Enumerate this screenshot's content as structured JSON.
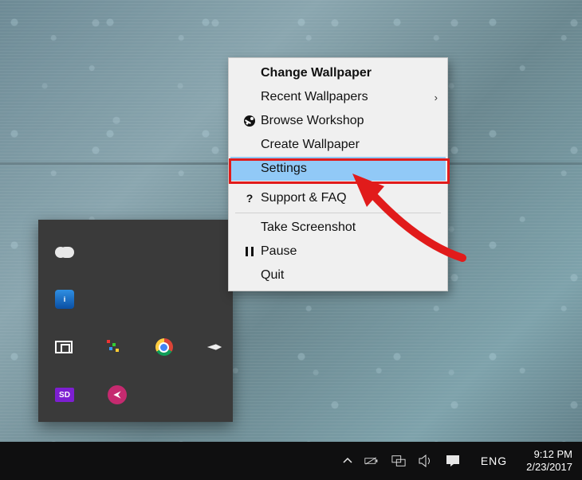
{
  "context_menu": {
    "heading": "Change Wallpaper",
    "items": {
      "recent": {
        "label": "Recent Wallpapers",
        "has_submenu": true
      },
      "browse": {
        "label": "Browse Workshop"
      },
      "create": {
        "label": "Create Wallpaper"
      },
      "settings": {
        "label": "Settings",
        "selected": true
      },
      "support": {
        "label": "Support & FAQ"
      },
      "screenshot": {
        "label": "Take Screenshot"
      },
      "pause": {
        "label": "Pause"
      },
      "quit": {
        "label": "Quit"
      }
    }
  },
  "tray_overflow": {
    "icons": [
      {
        "name": "onedrive-icon"
      },
      {
        "name": "intel-graphics-icon"
      },
      {
        "name": "screen-connect-icon"
      },
      {
        "name": "pixel-app-icon"
      },
      {
        "name": "chrome-icon"
      },
      {
        "name": "jet-app-icon"
      },
      {
        "name": "sd-app-icon",
        "badge": "SD"
      },
      {
        "name": "media-app-icon"
      }
    ]
  },
  "taskbar": {
    "language": "ENG",
    "time": "9:12 PM",
    "date": "2/23/2017"
  }
}
